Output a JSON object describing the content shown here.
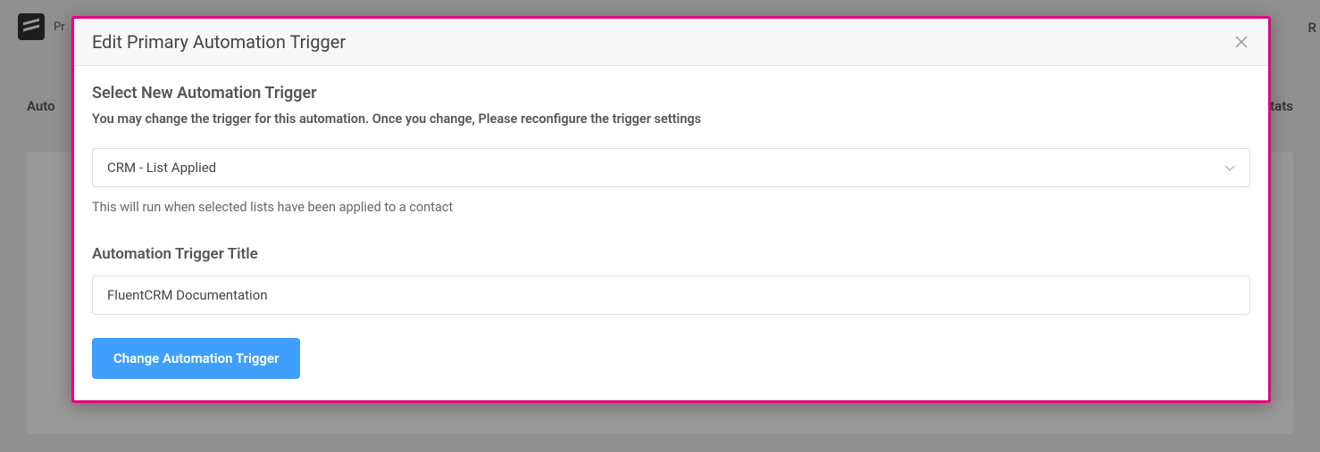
{
  "background": {
    "tab_left": "Auto",
    "tab_right": "Stats",
    "right_partial": "R",
    "logo_text": "Pr"
  },
  "modal": {
    "title": "Edit Primary Automation Trigger",
    "section_title": "Select New Automation Trigger",
    "section_desc": "You may change the trigger for this automation. Once you change, Please reconfigure the trigger settings",
    "select_value": "CRM - List Applied",
    "helper_text": "This will run when selected lists have been applied to a contact",
    "title_label": "Automation Trigger Title",
    "title_value": "FluentCRM Documentation",
    "submit_label": "Change Automation Trigger"
  }
}
